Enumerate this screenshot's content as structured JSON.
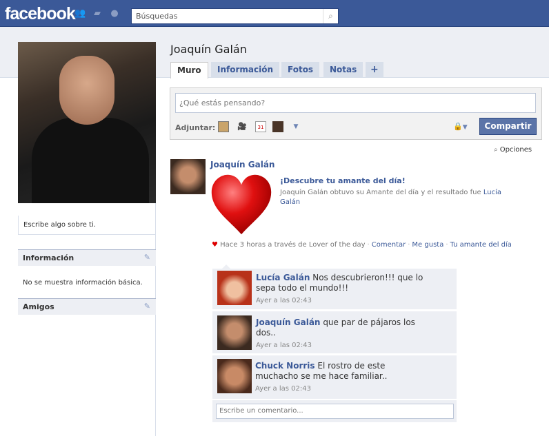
{
  "header": {
    "logo": "facebook",
    "search_placeholder": "Búsquedas",
    "icons": [
      "friends-icon",
      "messages-icon",
      "notifications-icon",
      "search-icon"
    ]
  },
  "profile": {
    "name": "Joaquín Galán",
    "about_placeholder": "Escribe algo sobre ti.",
    "sections": [
      {
        "title": "Información",
        "body": "No se muestra información básica."
      },
      {
        "title": "Amigos"
      }
    ]
  },
  "tabs": [
    {
      "label": "Muro",
      "active": true
    },
    {
      "label": "Información"
    },
    {
      "label": "Fotos"
    },
    {
      "label": "Notas"
    },
    {
      "label": "+"
    }
  ],
  "composer": {
    "placeholder": "¿Qué estás pensando?",
    "attach_label": "Adjuntar:",
    "share_label": "Compartir"
  },
  "options_label": "Opciones",
  "post": {
    "author": "Joaquín Galán",
    "app_title": "¡Descubre tu amante del día!",
    "desc_prefix": "Joaquín Galán obtuvo su Amante del día y el resultado fue",
    "desc_link": "Lucía Galán",
    "meta": "Hace 3 horas a través de Lover of the day",
    "actions": [
      "Comentar",
      "Me gusta",
      "Tu amante del día"
    ]
  },
  "comments": [
    {
      "author": "Lucía Galán",
      "text": "Nos descubrieron!!! que lo sepa todo el mundo!!!",
      "time": "Ayer a las 02:43"
    },
    {
      "author": "Joaquín Galán",
      "text": "que par de pájaros los dos..",
      "time": "Ayer a las 02:43"
    },
    {
      "author": "Chuck Norris",
      "text": "El rostro de este muchacho se me hace familiar..",
      "time": "Ayer a las 02:43"
    }
  ],
  "comment_placeholder": "Escribe un comentario..."
}
